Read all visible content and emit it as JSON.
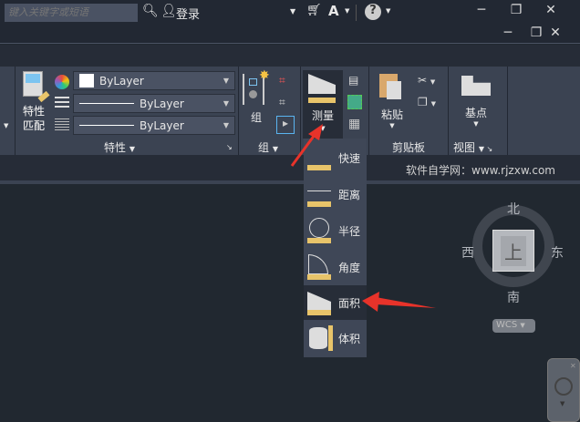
{
  "topbar": {
    "search_placeholder": "键入关键字或短语",
    "login": "登录"
  },
  "ribbon": {
    "match_props": "特性匹配",
    "match_props_l1": "特性",
    "match_props_l2": "匹配",
    "color": "ByLayer",
    "linetype": "ByLayer",
    "lineweight": "ByLayer",
    "props_title": "特性",
    "group_btn": "组",
    "group_title": "组",
    "measure_btn": "测量",
    "paste_btn": "粘贴",
    "clipboard_title": "剪贴板",
    "basepoint_btn": "基点",
    "view_title": "视图"
  },
  "menu": {
    "items": [
      {
        "label": "快速"
      },
      {
        "label": "距离"
      },
      {
        "label": "半径"
      },
      {
        "label": "角度"
      },
      {
        "label": "面积",
        "selected": true
      },
      {
        "label": "体积"
      }
    ]
  },
  "watermark": "软件自学网：www.rjzxw.com",
  "viewcube": {
    "north": "北",
    "south": "南",
    "east": "东",
    "west": "西",
    "face": "上",
    "wcs": "WCS"
  },
  "colors": {
    "accent_arrow": "#e8332a",
    "ruler": "#e8c46a"
  }
}
